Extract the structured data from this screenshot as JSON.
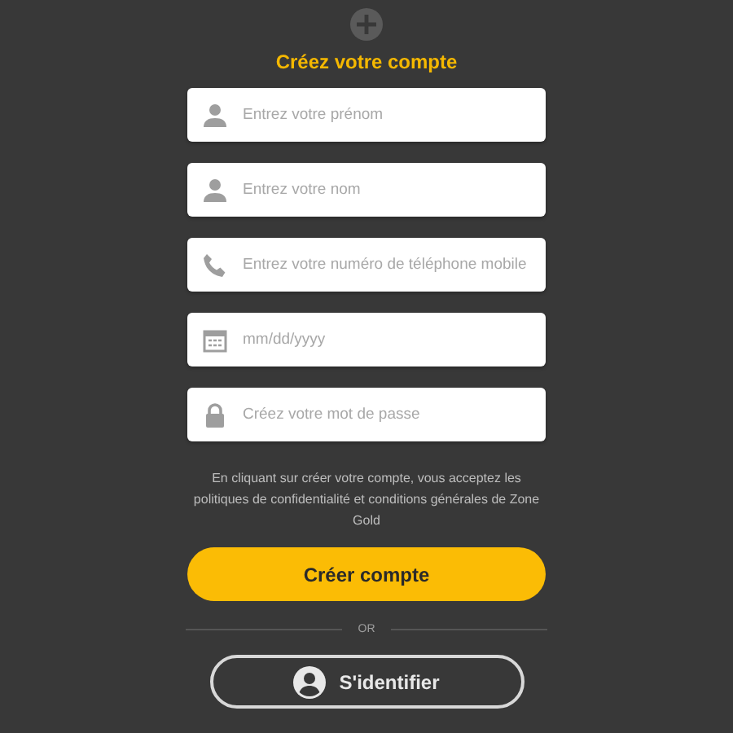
{
  "title": "Créez votre compte",
  "fields": [
    {
      "kind": "person",
      "placeholder": "Entrez votre prénom"
    },
    {
      "kind": "person",
      "placeholder": "Entrez votre nom"
    },
    {
      "kind": "phone",
      "placeholder": "Entrez votre numéro de téléphone mobile"
    },
    {
      "kind": "calendar",
      "placeholder": "mm/dd/yyyy"
    },
    {
      "kind": "lock",
      "placeholder": "Créez votre mot de passe"
    }
  ],
  "disclaimer": "En cliquant sur créer votre compte, vous acceptez les politiques de confidentialité et conditions générales de Zone Gold",
  "submit_button": "Créer compte",
  "divider_label": "OR",
  "login_button": "S'identifier"
}
